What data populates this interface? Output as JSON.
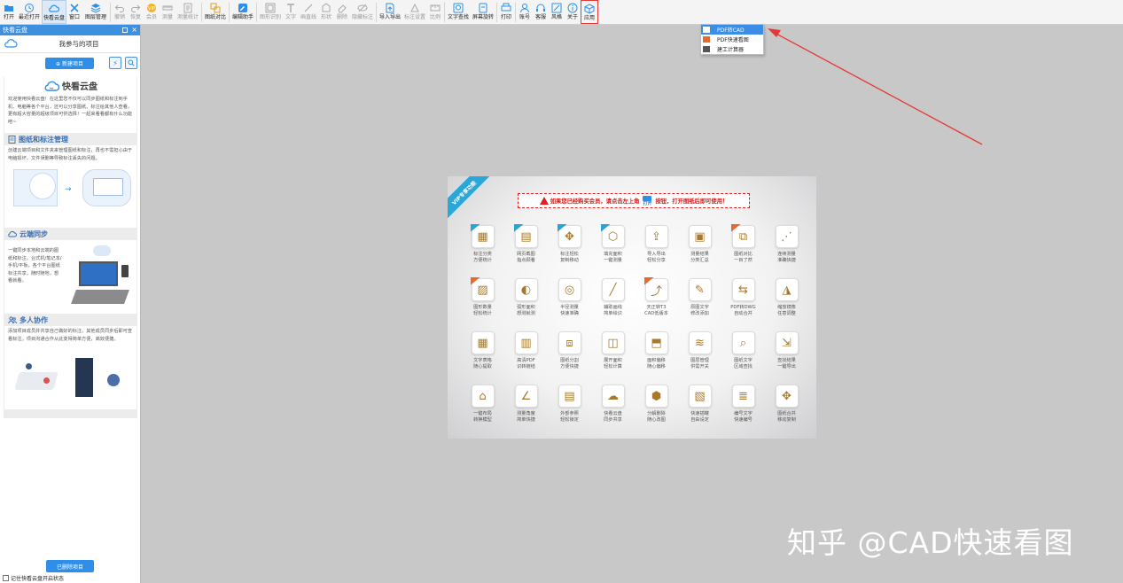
{
  "toolbar": {
    "items": [
      {
        "label": "打开",
        "icon": "open-folder-icon",
        "state": "normal"
      },
      {
        "label": "最近打开",
        "icon": "clock-icon",
        "state": "normal"
      },
      {
        "label": "快看云盘",
        "icon": "cloud-icon",
        "state": "active"
      },
      {
        "label": "窗口",
        "icon": "window-icon",
        "state": "normal"
      },
      {
        "label": "图层管理",
        "icon": "layers-icon",
        "state": "normal"
      },
      {
        "label": "撤销",
        "icon": "undo-icon",
        "state": "disabled"
      },
      {
        "label": "恢复",
        "icon": "redo-icon",
        "state": "disabled"
      },
      {
        "label": "会员",
        "icon": "vip-icon",
        "state": "disabled"
      },
      {
        "label": "测量",
        "icon": "ruler-icon",
        "state": "disabled"
      },
      {
        "label": "测量统计",
        "icon": "measure-stats-icon",
        "state": "disabled"
      },
      {
        "label": "图纸对比",
        "icon": "compare-icon",
        "state": "normal"
      },
      {
        "label": "编辑助手",
        "icon": "edit-assistant-icon",
        "state": "normal"
      },
      {
        "label": "图形识别",
        "icon": "shape-recognize-icon",
        "state": "disabled"
      },
      {
        "label": "文字",
        "icon": "text-icon",
        "state": "disabled"
      },
      {
        "label": "画直线",
        "icon": "line-icon",
        "state": "disabled"
      },
      {
        "label": "形状",
        "icon": "shape-icon",
        "state": "disabled"
      },
      {
        "label": "删除",
        "icon": "eraser-icon",
        "state": "disabled"
      },
      {
        "label": "隐藏标注",
        "icon": "hide-annotation-icon",
        "state": "disabled"
      },
      {
        "label": "导入导出",
        "icon": "import-export-icon",
        "state": "normal"
      },
      {
        "label": "标注设置",
        "icon": "annotation-settings-icon",
        "state": "disabled"
      },
      {
        "label": "比例",
        "icon": "scale-icon",
        "state": "disabled"
      },
      {
        "label": "文字查找",
        "icon": "text-search-icon",
        "state": "normal"
      },
      {
        "label": "屏幕旋转",
        "icon": "rotate-screen-icon",
        "state": "normal"
      },
      {
        "label": "打印",
        "icon": "print-icon",
        "state": "normal"
      },
      {
        "label": "账号",
        "icon": "account-icon",
        "state": "normal"
      },
      {
        "label": "客服",
        "icon": "headset-icon",
        "state": "normal"
      },
      {
        "label": "风格",
        "icon": "style-icon",
        "state": "normal"
      },
      {
        "label": "关于",
        "icon": "info-icon",
        "state": "normal"
      },
      {
        "label": "应用",
        "icon": "apps-cube-icon",
        "state": "highlighted"
      }
    ],
    "colors": {
      "accent": "#3d8fe0",
      "highlight": "#e53935"
    }
  },
  "apps_menu": {
    "items": [
      {
        "label": "PDF转CAD",
        "icon": "pdf-to-cad-icon",
        "selected": true
      },
      {
        "label": "PDF快速看图",
        "icon": "pdf-viewer-icon",
        "selected": false
      },
      {
        "label": "建工计算器",
        "icon": "calculator-icon",
        "selected": false
      }
    ]
  },
  "panel": {
    "title": "快看云盘",
    "project_header": "我参与的项目",
    "new_project": "⊕ 新建项目",
    "cloud_title": "快看云盘",
    "intro": "欢迎使用快看云盘！在这里您不仅可以同步图纸和标注到手机、电脑等各个平台，还可以分享图纸、标注给其他人查看，更有超大容量的超级项目可供选择！一起来看看都有什么功能吧~",
    "sections": [
      {
        "title": "图纸和标注管理",
        "icon": "document-icon",
        "text": "创建云端项目和文件夹来管理图纸和标注，再也不需担心由于电脑损坏，文件误删等导致标注丢失的问题。"
      },
      {
        "title": "云端同步",
        "icon": "sync-icon",
        "text": "一键同步本地和云端的图纸和标注，台式机/笔记本/手机/平板，各个平台图纸标注共享，随时随地，想看就看。"
      },
      {
        "title": "多人协作",
        "icon": "team-icon",
        "text": "添加项目成员并共享自己做好的标注，其他成员同步后即可查看标注。项目沟通合作从此变得简单方便，高效便捷。"
      }
    ],
    "deleted_projects": "已删除项目",
    "remember_label": "记住快看云盘开启状态"
  },
  "promo": {
    "ribbon": "VIP专享功能",
    "warning_pre": "如果您已经购买会员，请点击左上角",
    "warning_open": "打开",
    "warning_post": "按钮，打开图纸后即可使用！",
    "features": [
      {
        "l1": "标注分类",
        "l2": "方便统计",
        "icon": "category-grid-icon",
        "badge": "#29a3d6"
      },
      {
        "l1": "网页截图",
        "l2": "指点顾看",
        "icon": "web-capture-icon",
        "badge": "#29a3d6"
      },
      {
        "l1": "标注轻松",
        "l2": "复制移动",
        "icon": "move-arrows-icon",
        "badge": "#29a3d6"
      },
      {
        "l1": "填充面积",
        "l2": "一键测量",
        "icon": "fill-area-icon",
        "badge": "#29a3d6"
      },
      {
        "l1": "导入导出",
        "l2": "轻松分享",
        "icon": "import-share-icon",
        "badge": ""
      },
      {
        "l1": "测量结果",
        "l2": "分类汇总",
        "icon": "summary-icon",
        "badge": ""
      },
      {
        "l1": "图纸对比",
        "l2": "一目了然",
        "icon": "drawing-compare-icon",
        "badge": "#e8692e"
      },
      {
        "l1": "连续测量",
        "l2": "准确快捷",
        "icon": "continuous-measure-icon",
        "badge": ""
      },
      {
        "l1": "图形数量",
        "l2": "轻松统计",
        "icon": "shape-count-icon",
        "badge": "#e8692e"
      },
      {
        "l1": "弧形面积",
        "l2": "想测就测",
        "icon": "arc-area-icon",
        "badge": ""
      },
      {
        "l1": "半径测量",
        "l2": "快速准确",
        "icon": "radius-icon",
        "badge": ""
      },
      {
        "l1": "辅助画线",
        "l2": "简单绘识",
        "icon": "assist-line-icon",
        "badge": ""
      },
      {
        "l1": "天正转T3",
        "l2": "CAD低版本",
        "icon": "convert-t3-icon",
        "badge": "#e8692e"
      },
      {
        "l1": "原图文字",
        "l2": "修改添加",
        "icon": "edit-text-icon",
        "badge": ""
      },
      {
        "l1": "PDF转DWG",
        "l2": "自动合并",
        "icon": "pdf-to-dwg-icon",
        "badge": ""
      },
      {
        "l1": "缩放镜像",
        "l2": "任意调整",
        "icon": "mirror-icon",
        "badge": ""
      },
      {
        "l1": "文字表格",
        "l2": "随心提取",
        "icon": "table-extract-icon",
        "badge": ""
      },
      {
        "l1": "高清PDF",
        "l2": "识转链结",
        "icon": "hd-pdf-icon",
        "badge": ""
      },
      {
        "l1": "图纸分割",
        "l2": "方便快捷",
        "icon": "split-icon",
        "badge": ""
      },
      {
        "l1": "展开面积",
        "l2": "轻松计算",
        "icon": "unfold-area-icon",
        "badge": ""
      },
      {
        "l1": "面积偏移",
        "l2": "随心偏移",
        "icon": "area-offset-icon",
        "badge": ""
      },
      {
        "l1": "图层管理",
        "l2": "供需开关",
        "icon": "layer-manage-icon",
        "badge": ""
      },
      {
        "l1": "图纸文字",
        "l2": "区域查找",
        "icon": "text-region-search-icon",
        "badge": ""
      },
      {
        "l1": "查找结果",
        "l2": "一键导出",
        "icon": "export-result-icon",
        "badge": ""
      },
      {
        "l1": "一键布局",
        "l2": "转换模型",
        "icon": "layout-convert-icon",
        "badge": ""
      },
      {
        "l1": "测量角度",
        "l2": "简单快捷",
        "icon": "angle-icon",
        "badge": ""
      },
      {
        "l1": "外部参照",
        "l2": "轻松锁定",
        "icon": "xref-lock-icon",
        "badge": ""
      },
      {
        "l1": "快看云盘",
        "l2": "同步共享",
        "icon": "cloud-share-icon",
        "badge": ""
      },
      {
        "l1": "分解删除",
        "l2": "随心改图",
        "icon": "explode-icon",
        "badge": ""
      },
      {
        "l1": "快速插罐",
        "l2": "自由设定",
        "icon": "insert-block-icon",
        "badge": ""
      },
      {
        "l1": "编号文字",
        "l2": "快速编号",
        "icon": "numbering-icon",
        "badge": ""
      },
      {
        "l1": "图纸合并",
        "l2": "移动复制",
        "icon": "merge-move-icon",
        "badge": ""
      }
    ]
  },
  "watermark": "知乎 @CAD快速看图"
}
